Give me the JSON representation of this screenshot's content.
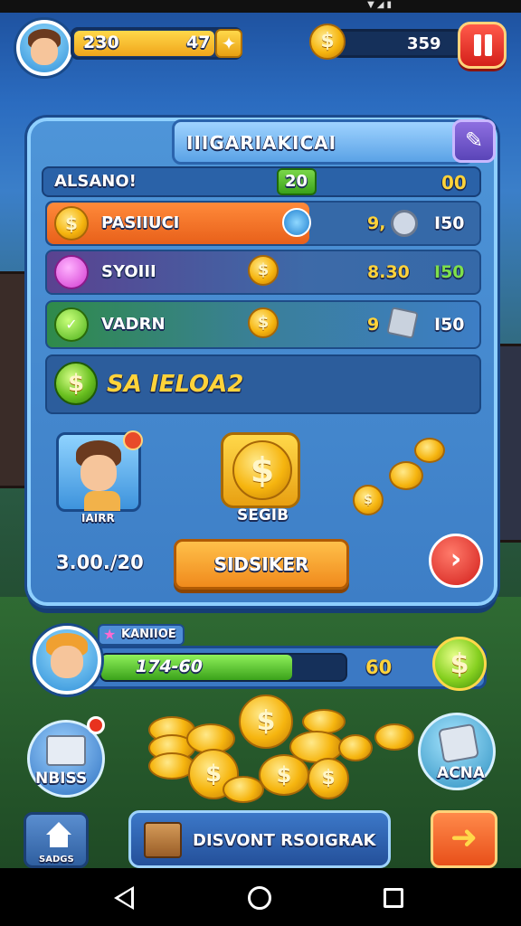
{
  "hud": {
    "level_text": "230",
    "xp_text": "47",
    "coin_count": "359",
    "coin_symbol": "$",
    "pause_icon": "pause-icon"
  },
  "panel": {
    "title": "IIIGARIAKICAI",
    "header_label": "ALSANO!",
    "header_count": "20",
    "header_value": "00",
    "rows": [
      {
        "label": "PASIIUCI",
        "value": "9,",
        "value2": "I50"
      },
      {
        "label": "SYOIII",
        "value": "8.30",
        "value2": "I50"
      },
      {
        "label": "VADRN",
        "value": "9",
        "value2": "I50"
      }
    ],
    "banner_text": "SA IELOA2",
    "char_label": "IAIRR",
    "chest_label": "SEGIB",
    "amount_text": "3.00./20",
    "action_button": "SIDSIKER"
  },
  "progress": {
    "tag": "KANIIOE",
    "bar_text": "174-60",
    "value": "60",
    "fill": 0.78
  },
  "side_left_label": "NBISS",
  "side_right_label": "ACNA",
  "bottom": {
    "home_label": "SADGS",
    "center_label": "DISVONT RSOIGRAK"
  },
  "colors": {
    "accent_orange": "#f08a1c",
    "accent_green": "#5ecb2a",
    "panel_blue": "#4e95d8",
    "red_button": "#e0312a"
  }
}
